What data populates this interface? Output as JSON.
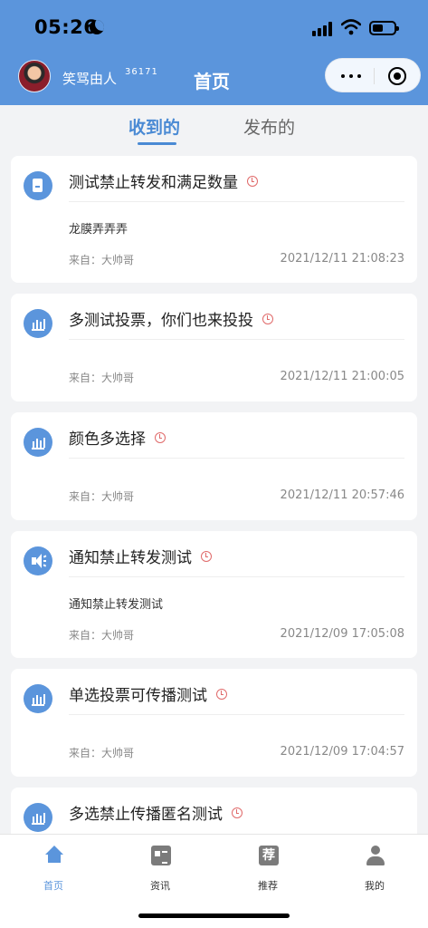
{
  "status_bar": {
    "time": "05:26"
  },
  "header": {
    "username": "笑骂由人",
    "user_sup": "36171",
    "title": "首页"
  },
  "tabs": [
    {
      "label": "收到的",
      "active": true
    },
    {
      "label": "发布的",
      "active": false
    }
  ],
  "notices": [
    {
      "icon": "document-icon",
      "title": "测试禁止转发和满足数量",
      "body": "龙膜弄弄弄",
      "from": "来自：大帅哥",
      "time": "2021/12/11 21:08:23"
    },
    {
      "icon": "bar-chart-icon",
      "title": "多测试投票，你们也来投投",
      "body": "",
      "from": "来自：大帅哥",
      "time": "2021/12/11 21:00:05"
    },
    {
      "icon": "bar-chart-icon",
      "title": "颜色多选择",
      "body": "",
      "from": "来自：大帅哥",
      "time": "2021/12/11 20:57:46"
    },
    {
      "icon": "megaphone-icon",
      "title": "通知禁止转发测试",
      "body": "通知禁止转发测试",
      "from": "来自：大帅哥",
      "time": "2021/12/09 17:05:08"
    },
    {
      "icon": "bar-chart-icon",
      "title": "单选投票可传播测试",
      "body": "",
      "from": "来自：大帅哥",
      "time": "2021/12/09 17:04:57"
    },
    {
      "icon": "bar-chart-icon",
      "title": "多选禁止传播匿名测试",
      "body": "",
      "from": "",
      "time": ""
    }
  ],
  "tabbar": [
    {
      "label": "首页",
      "icon": "home-icon",
      "active": true
    },
    {
      "label": "资讯",
      "icon": "news-icon",
      "active": false
    },
    {
      "label": "推荐",
      "icon": "recommend-icon",
      "icon_text": "荐",
      "active": false
    },
    {
      "label": "我的",
      "icon": "person-icon",
      "active": false
    }
  ],
  "colors": {
    "brand": "#5b95dc",
    "accent": "#4a8ad4",
    "clock": "#e06a6a"
  }
}
